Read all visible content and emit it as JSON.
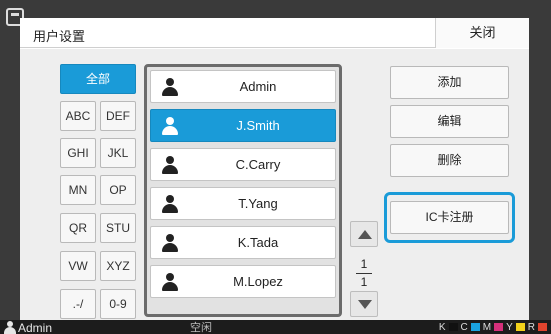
{
  "dialog": {
    "title": "用户设置",
    "close_label": "关闭"
  },
  "filters": {
    "all_label": "全部",
    "items": [
      "ABC",
      "DEF",
      "GHI",
      "JKL",
      "MN",
      "OP",
      "QR",
      "STU",
      "VW",
      "XYZ",
      ".-/",
      "0-9"
    ]
  },
  "users": {
    "items": [
      {
        "name": "Admin",
        "selected": false
      },
      {
        "name": "J.Smith",
        "selected": true
      },
      {
        "name": "C.Carry",
        "selected": false
      },
      {
        "name": "T.Yang",
        "selected": false
      },
      {
        "name": "K.Tada",
        "selected": false
      },
      {
        "name": "M.Lopez",
        "selected": false
      }
    ]
  },
  "pager": {
    "current": "1",
    "total": "1"
  },
  "actions": {
    "add": "添加",
    "edit": "编辑",
    "delete": "删除",
    "ic_register": "IC卡注册"
  },
  "status": {
    "user": "Admin",
    "state": "空闲",
    "ink_labels": [
      "K",
      "C",
      "M",
      "Y",
      "R"
    ],
    "ink_colors": [
      "#111111",
      "#1aa3e0",
      "#d6307b",
      "#f2d21b",
      "#e0442e"
    ]
  },
  "colors": {
    "accent": "#1a9bd8"
  }
}
